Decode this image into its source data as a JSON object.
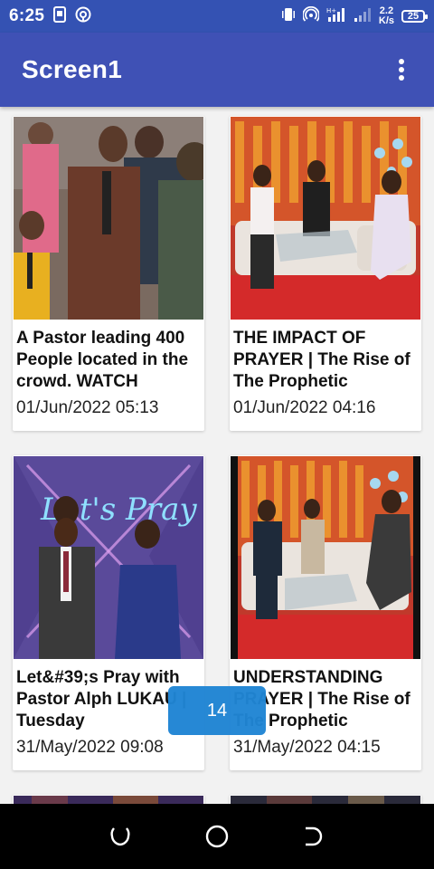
{
  "status_bar": {
    "time": "6:25",
    "speed_value": "2.2",
    "speed_unit": "K/s",
    "battery": "25",
    "icons": [
      "sim-card-icon",
      "cast-icon",
      "vibrate-icon",
      "hotspot-icon",
      "signal-4g-icon",
      "signal-bars-icon",
      "battery-icon"
    ]
  },
  "app_bar": {
    "title": "Screen1",
    "menu_icon": "more-vert-icon"
  },
  "cards": [
    {
      "title": "A Pastor leading 400 People located in the crowd. WATCH",
      "date": "01/Jun/2022 05:13"
    },
    {
      "title": "THE IMPACT OF PRAYER | The Rise of The Prophetic",
      "date": "01/Jun/2022 04:16"
    },
    {
      "title": "Let&#39;s Pray with Pastor Alph LUKAU | Tuesday",
      "date": "31/May/2022 09:08"
    },
    {
      "title": "UNDERSTANDING PRAYER | The Rise of The Prophetic",
      "date": "31/May/2022 04:15"
    }
  ],
  "page_indicator": "14",
  "nav_bar": {
    "icons": [
      "recents-icon",
      "home-icon",
      "back-icon"
    ]
  },
  "colors": {
    "status_bar": "#3452b3",
    "app_bar": "#3f51b5",
    "page_indicator": "#2085d4",
    "nav_bar": "#000000"
  }
}
